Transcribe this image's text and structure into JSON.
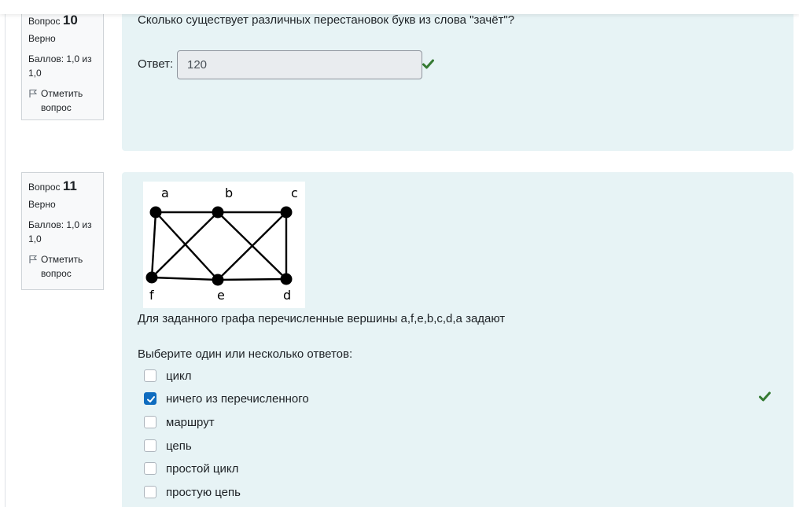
{
  "question10": {
    "number_prefix": "Вопрос",
    "number": "10",
    "state": "Верно",
    "grade": "Баллов: 1,0 из 1,0",
    "flag_label": "Отметить вопрос",
    "text": "Сколько существует различных перестановок букв из слова \"зачёт\"?",
    "answer_label": "Ответ:",
    "answer_value": "120"
  },
  "question11": {
    "number_prefix": "Вопрос",
    "number": "11",
    "state": "Верно",
    "grade": "Баллов: 1,0 из 1,0",
    "flag_label": "Отметить вопрос",
    "graph_labels": {
      "a": "a",
      "b": "b",
      "c": "c",
      "d": "d",
      "e": "e",
      "f": "f"
    },
    "text": "Для заданного графа перечисленные вершины a,f,e,b,c,d,a задают",
    "prompt": "Выберите один или несколько ответов:",
    "options": [
      {
        "label": "цикл",
        "checked": false
      },
      {
        "label": "ничего из перечисленного",
        "checked": true
      },
      {
        "label": "маршрут",
        "checked": false
      },
      {
        "label": "цепь",
        "checked": false
      },
      {
        "label": "простой цикл",
        "checked": false
      },
      {
        "label": "простую цепь",
        "checked": false
      }
    ]
  },
  "colors": {
    "correct_green": "#357a32",
    "checkbox_blue": "#0f6cbf",
    "content_bg": "#e7f3f5"
  },
  "icons": {
    "flag": "flag-icon",
    "correct": "check-icon"
  }
}
